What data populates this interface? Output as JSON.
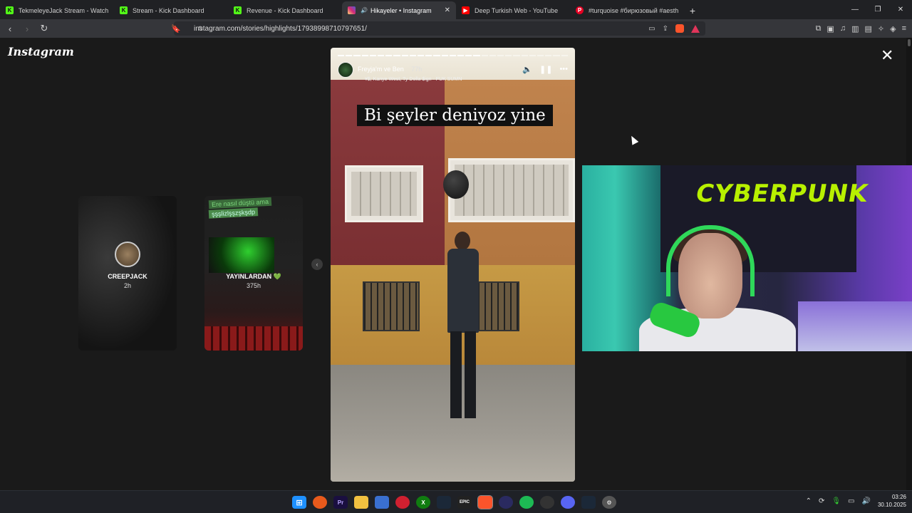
{
  "tabs": [
    {
      "label": "TekmeleyeJack Stream - Watch Live o",
      "icon": "kick-icon",
      "color": "#53fc18"
    },
    {
      "label": "Stream - Kick Dashboard",
      "icon": "kick-icon",
      "color": "#53fc18"
    },
    {
      "label": "Revenue - Kick Dashboard",
      "icon": "kick-icon",
      "color": "#53fc18"
    },
    {
      "label": "Hikayeler • Instagram",
      "icon": "instagram-icon",
      "color": "#e1306c",
      "active": true
    },
    {
      "label": "Deep Turkish Web - YouTube",
      "icon": "youtube-icon",
      "color": "#ff0000"
    },
    {
      "label": "#turquoise #бирюзовый #aesthetic",
      "icon": "pinterest-icon",
      "color": "#e60023"
    }
  ],
  "address": {
    "url": "instagram.com/stories/highlights/17938998710797651/"
  },
  "page": {
    "logo": "Instagram",
    "close_icon": "close-icon"
  },
  "side_stories": [
    {
      "name": "CREEPJACK",
      "time": "2h"
    },
    {
      "name": "YAYINLARDAN 💚",
      "time": "375h",
      "sticker_top": "Ere nasıl düştü ama",
      "sticker_bottom": "şşşlizlşşzşkşdp"
    }
  ],
  "story": {
    "username": "Freyja'm ve Ben",
    "age": "77h",
    "music": "¥$, Kanye West, Ty Dolla $ign · FUK SUMN",
    "caption": "Bi şeyler deniyoz yine",
    "progress_segments": 29,
    "progress_done": 18
  },
  "webcam": {
    "poster_text": "CYBERPUNK"
  },
  "taskbar": {
    "time": "03:26",
    "date": "30.10.2025"
  }
}
